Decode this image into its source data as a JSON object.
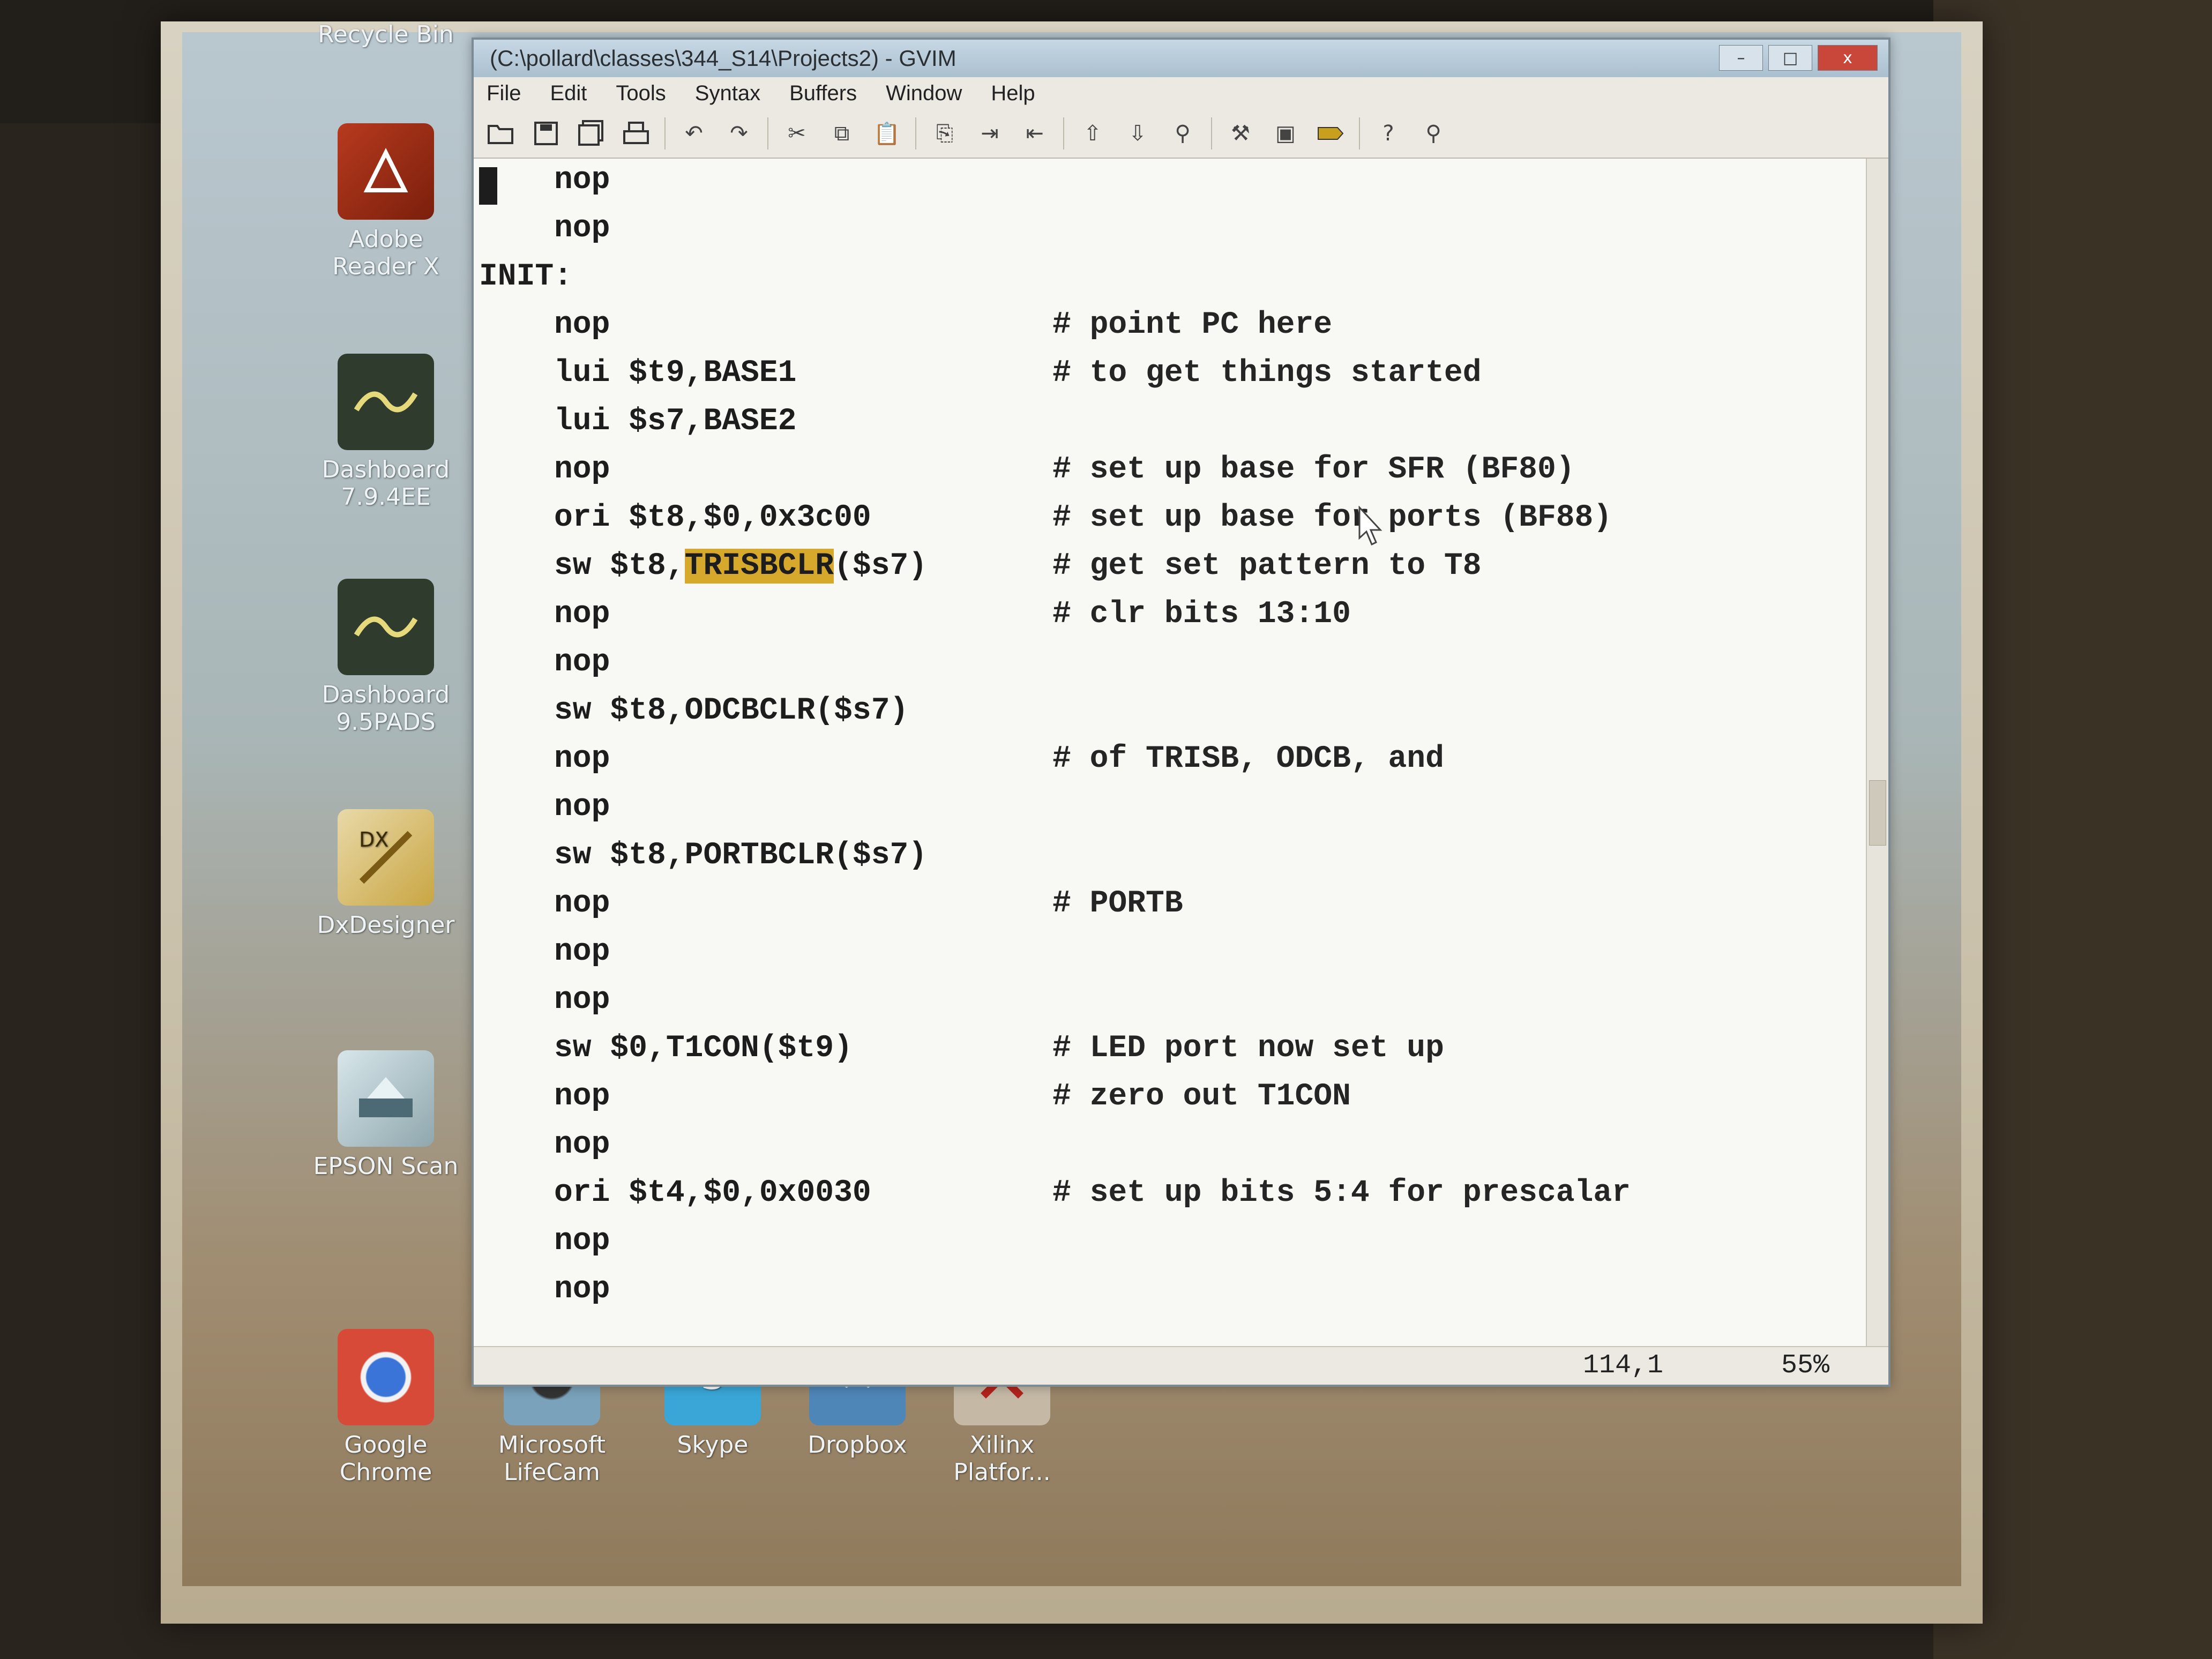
{
  "window": {
    "title": "(C:\\pollard\\classes\\344_S14\\Projects2) - GVIM",
    "controls": [
      "–",
      "□",
      "x"
    ]
  },
  "menu": [
    "File",
    "Edit",
    "Tools",
    "Syntax",
    "Buffers",
    "Window",
    "Help"
  ],
  "toolbar_icons": [
    "open-icon",
    "save-icon",
    "save-all-icon",
    "print-icon",
    "undo-icon",
    "redo-icon",
    "cut-icon",
    "copy-icon",
    "paste-icon",
    "find-replace-icon",
    "find-next-icon",
    "find-prev-icon",
    "load-session-icon",
    "save-session-icon",
    "run-script-icon",
    "make-icon",
    "shell-icon",
    "tag-icon",
    "help-icon",
    "find-help-icon"
  ],
  "code_lines": [
    {
      "label": "",
      "instr": "nop",
      "comment": ""
    },
    {
      "label": "",
      "instr": "nop",
      "comment": ""
    },
    {
      "label": "INIT:",
      "instr": "",
      "comment": ""
    },
    {
      "label": "",
      "instr": "nop",
      "comment": "# point PC here"
    },
    {
      "label": "",
      "instr": "lui $t9,BASE1",
      "comment": "# to get things started"
    },
    {
      "label": "",
      "instr": "lui $s7,BASE2",
      "comment": ""
    },
    {
      "label": "",
      "instr": "nop",
      "comment": "# set up base for SFR (BF80)"
    },
    {
      "label": "",
      "instr": "ori $t8,$0,0x3c00",
      "comment": "# set up base for ports (BF88)"
    },
    {
      "label": "",
      "instr_pre": "sw $t8,",
      "instr_hl": "TRISBCLR",
      "instr_post": "($s7)",
      "comment": "# get set pattern to T8"
    },
    {
      "label": "",
      "instr": "nop",
      "comment": "# clr bits 13:10"
    },
    {
      "label": "",
      "instr": "nop",
      "comment": ""
    },
    {
      "label": "",
      "instr": "sw $t8,ODCBCLR($s7)",
      "comment": ""
    },
    {
      "label": "",
      "instr": "nop",
      "comment": "# of TRISB, ODCB, and"
    },
    {
      "label": "",
      "instr": "nop",
      "comment": ""
    },
    {
      "label": "",
      "instr": "sw $t8,PORTBCLR($s7)",
      "comment": ""
    },
    {
      "label": "",
      "instr": "nop",
      "comment": "# PORTB"
    },
    {
      "label": "",
      "instr": "nop",
      "comment": ""
    },
    {
      "label": "",
      "instr": "nop",
      "comment": ""
    },
    {
      "label": "",
      "instr": "sw $0,T1CON($t9)",
      "comment": "# LED port now set up"
    },
    {
      "label": "",
      "instr": "nop",
      "comment": "# zero out T1CON"
    },
    {
      "label": "",
      "instr": "nop",
      "comment": ""
    },
    {
      "label": "",
      "instr": "ori $t4,$0,0x0030",
      "comment": "# set up bits 5:4 for prescalar"
    },
    {
      "label": "",
      "instr": "nop",
      "comment": ""
    },
    {
      "label": "",
      "instr": "nop",
      "comment": ""
    }
  ],
  "status": {
    "position": "114,1",
    "percent": "55%"
  },
  "desktop_icons": {
    "left": [
      {
        "name": "Recycle Bin",
        "icon": "recycle-bin-icon"
      },
      {
        "name": "Adobe Reader X",
        "icon": "adobe-reader-icon"
      },
      {
        "name": "Dashboard 7.9.4EE",
        "icon": "dashboard-icon"
      },
      {
        "name": "Dashboard 9.5PADS",
        "icon": "dashboard-icon"
      },
      {
        "name": "DxDesigner",
        "icon": "dxdesigner-icon"
      },
      {
        "name": "EPSON Scan",
        "icon": "scanner-icon"
      }
    ],
    "bottom": [
      {
        "name": "Google Chrome",
        "icon": "chrome-icon"
      },
      {
        "name": "Microsoft LifeCam",
        "icon": "webcam-icon"
      },
      {
        "name": "Skype",
        "icon": "skype-icon"
      },
      {
        "name": "Dropbox",
        "icon": "dropbox-icon"
      },
      {
        "name": "Xilinx Platfor...",
        "icon": "xilinx-icon"
      }
    ]
  }
}
